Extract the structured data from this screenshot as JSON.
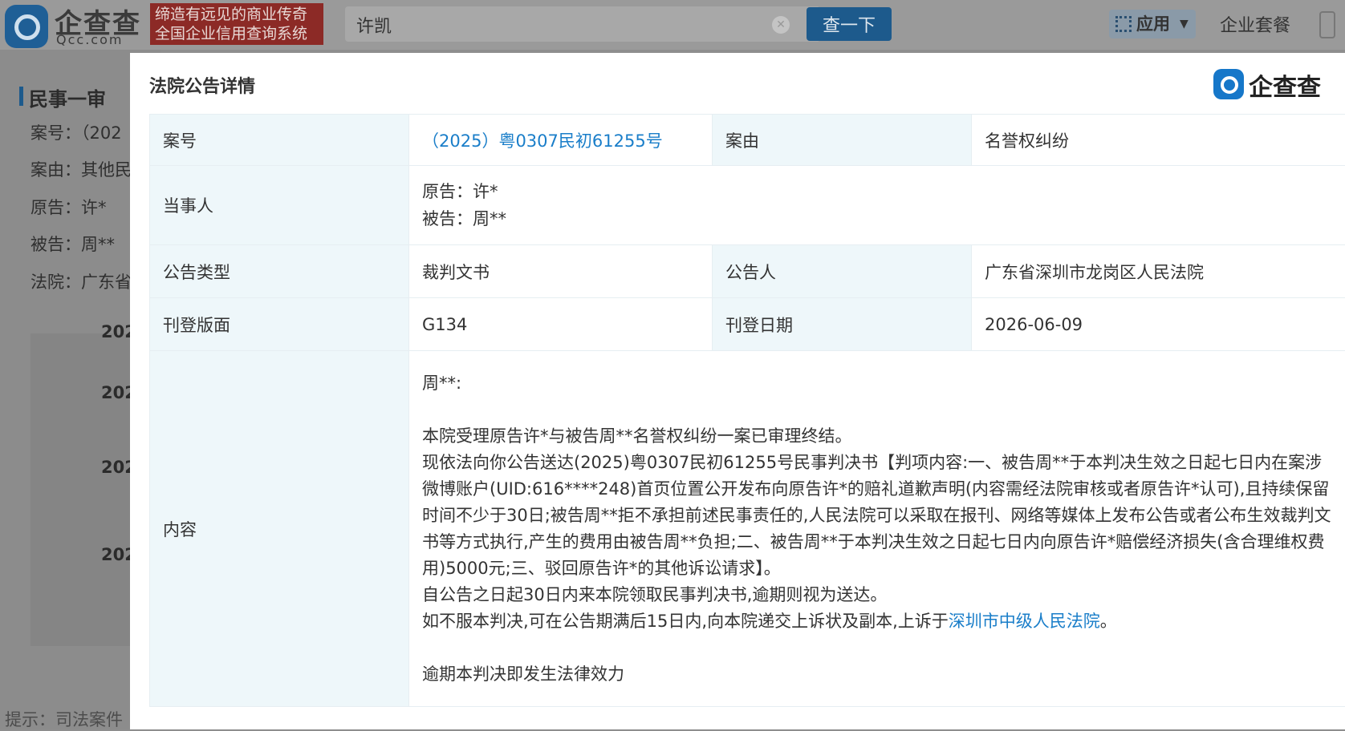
{
  "topbar": {
    "brand_cn": "企查查",
    "brand_en": "Qcc.com",
    "slogan_line1": "缔造有远见的商业传奇",
    "slogan_line2": "全国企业信用查询系统",
    "search_value": "许凯",
    "search_button": "查一下",
    "apps_label": "应用",
    "package_label": "企业套餐"
  },
  "background": {
    "section_title": "民事一审",
    "lines": [
      "案号：（202",
      "案由：其他民",
      "原告：许*",
      "被告：周**",
      "法院：广东省"
    ],
    "years": [
      "202",
      "202",
      "202",
      "202"
    ],
    "tip": "提示：司法案件"
  },
  "modal": {
    "title": "法院公告详情",
    "logo_text": "企查查",
    "rows": {
      "case_no_label": "案号",
      "case_no_value": "（2025）粤0307民初61255号",
      "cause_label": "案由",
      "cause_value": "名誉权纠纷",
      "parties_label": "当事人",
      "plaintiff": "原告：许*",
      "defendant": "被告：周**",
      "type_label": "公告类型",
      "type_value": "裁判文书",
      "announcer_label": "公告人",
      "announcer_value": "广东省深圳市龙岗区人民法院",
      "page_label": "刊登版面",
      "page_value": "G134",
      "date_label": "刊登日期",
      "date_value": "2026-06-09",
      "content_label": "内容"
    },
    "content": {
      "salutation": "周**:",
      "p1": "本院受理原告许*与被告周**名誉权纠纷一案已审理终结。",
      "p2": "现依法向你公告送达(2025)粤0307民初61255号民事判决书【判项内容:一、被告周**于本判决生效之日起七日内在案涉微博账户(UID:616****248)首页位置公开发布向原告许*的赔礼道歉声明(内容需经法院审核或者原告许*认可),且持续保留时间不少于30日;被告周**拒不承担前述民事责任的,人民法院可以采取在报刊、网络等媒体上发布公告或者公布生效裁判文书等方式执行,产生的费用由被告周**负担;二、被告周**于本判决生效之日起七日内向原告许*赔偿经济损失(含合理维权费用)5000元;三、驳回原告许*的其他诉讼请求】。",
      "p3": "自公告之日起30日内来本院领取民事判决书,逾期则视为送达。",
      "p4_prefix": "如不服本判决,可在公告期满后15日内,向本院递交上诉状及副本,上诉于",
      "p4_link": "深圳市中级人民法院",
      "p4_suffix": "。",
      "p5": "逾期本判决即发生法律效力"
    }
  }
}
